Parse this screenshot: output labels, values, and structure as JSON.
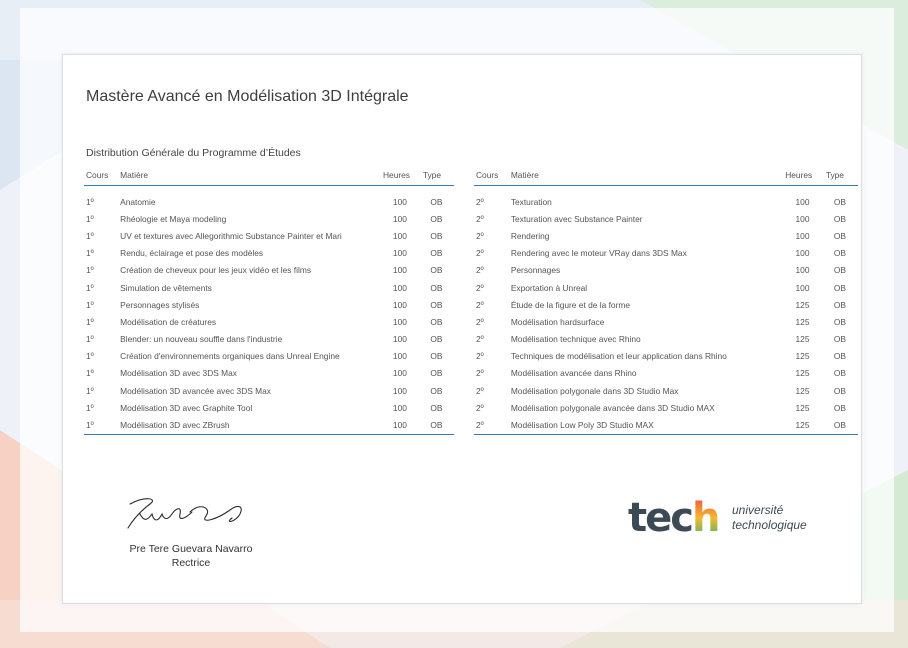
{
  "title": "Mastère Avancé en Modélisation 3D Intégrale",
  "subtitle": "Distribution Générale du Programme d’Études",
  "headers": {
    "cours": "Cours",
    "matiere": "Matière",
    "heures": "Heures",
    "type": "Type"
  },
  "left_rows": [
    {
      "cours": "1º",
      "matiere": "Anatomie",
      "heures": "100",
      "type": "OB"
    },
    {
      "cours": "1º",
      "matiere": "Rhéologie et Maya modeling",
      "heures": "100",
      "type": "OB"
    },
    {
      "cours": "1º",
      "matiere": "UV et textures avec Allegorithmic Substance Painter et Mari",
      "heures": "100",
      "type": "OB"
    },
    {
      "cours": "1º",
      "matiere": "Rendu, éclairage et pose des modèles",
      "heures": "100",
      "type": "OB"
    },
    {
      "cours": "1º",
      "matiere": "Création de cheveux pour les jeux vidéo et les films",
      "heures": "100",
      "type": "OB"
    },
    {
      "cours": "1º",
      "matiere": "Simulation de vêtements",
      "heures": "100",
      "type": "OB"
    },
    {
      "cours": "1º",
      "matiere": "Personnages stylisés",
      "heures": "100",
      "type": "OB"
    },
    {
      "cours": "1º",
      "matiere": "Modélisation de créatures",
      "heures": "100",
      "type": "OB"
    },
    {
      "cours": "1º",
      "matiere": "Blender: un nouveau souffle dans l'industrie",
      "heures": "100",
      "type": "OB"
    },
    {
      "cours": "1º",
      "matiere": "Création d'environnements organiques dans Unreal Engine",
      "heures": "100",
      "type": "OB"
    },
    {
      "cours": "1º",
      "matiere": "Modélisation 3D avec 3DS Max",
      "heures": "100",
      "type": "OB"
    },
    {
      "cours": "1º",
      "matiere": "Modélisation 3D avancée avec 3DS Max",
      "heures": "100",
      "type": "OB"
    },
    {
      "cours": "1º",
      "matiere": "Modélisation 3D avec Graphite Tool",
      "heures": "100",
      "type": "OB"
    },
    {
      "cours": "1º",
      "matiere": "Modélisation 3D avec ZBrush",
      "heures": "100",
      "type": "OB"
    }
  ],
  "right_rows": [
    {
      "cours": "2º",
      "matiere": "Texturation",
      "heures": "100",
      "type": "OB"
    },
    {
      "cours": "2º",
      "matiere": "Texturation avec Substance Painter",
      "heures": "100",
      "type": "OB"
    },
    {
      "cours": "2º",
      "matiere": "Rendering",
      "heures": "100",
      "type": "OB"
    },
    {
      "cours": "2º",
      "matiere": "Rendering avec le moteur VRay dans 3DS Max",
      "heures": "100",
      "type": "OB"
    },
    {
      "cours": "2º",
      "matiere": "Personnages",
      "heures": "100",
      "type": "OB"
    },
    {
      "cours": "2º",
      "matiere": "Exportation à Unreal",
      "heures": "100",
      "type": "OB"
    },
    {
      "cours": "2º",
      "matiere": "Étude de la figure et de la forme",
      "heures": "125",
      "type": "OB"
    },
    {
      "cours": "2º",
      "matiere": "Modélisation hardsurface",
      "heures": "125",
      "type": "OB"
    },
    {
      "cours": "2º",
      "matiere": "Modélisation technique avec Rhino",
      "heures": "125",
      "type": "OB"
    },
    {
      "cours": "2º",
      "matiere": "Techniques de modélisation et leur application dans Rhino",
      "heures": "125",
      "type": "OB"
    },
    {
      "cours": "2º",
      "matiere": "Modélisation avancée dans Rhino",
      "heures": "125",
      "type": "OB"
    },
    {
      "cours": "2º",
      "matiere": "Modélisation polygonale dans 3D Studio Max",
      "heures": "125",
      "type": "OB"
    },
    {
      "cours": "2º",
      "matiere": "Modélisation polygonale avancée dans 3D Studio MAX",
      "heures": "125",
      "type": "OB"
    },
    {
      "cours": "2º",
      "matiere": "Modélisation Low Poly 3D Studio MAX",
      "heures": "125",
      "type": "OB"
    }
  ],
  "signer": {
    "name": "Pre Tere Guevara Navarro",
    "role": "Rectrice"
  },
  "logo": {
    "word_main": "tec",
    "word_accent": "h",
    "line1": "université",
    "line2": "technologique"
  },
  "colors": {
    "accent_blue": "#2f7fc1",
    "logo_gray": "#3c4a55",
    "logo_h_gradient": [
      "#e84d3d",
      "#f7b733",
      "#2bb673"
    ]
  }
}
